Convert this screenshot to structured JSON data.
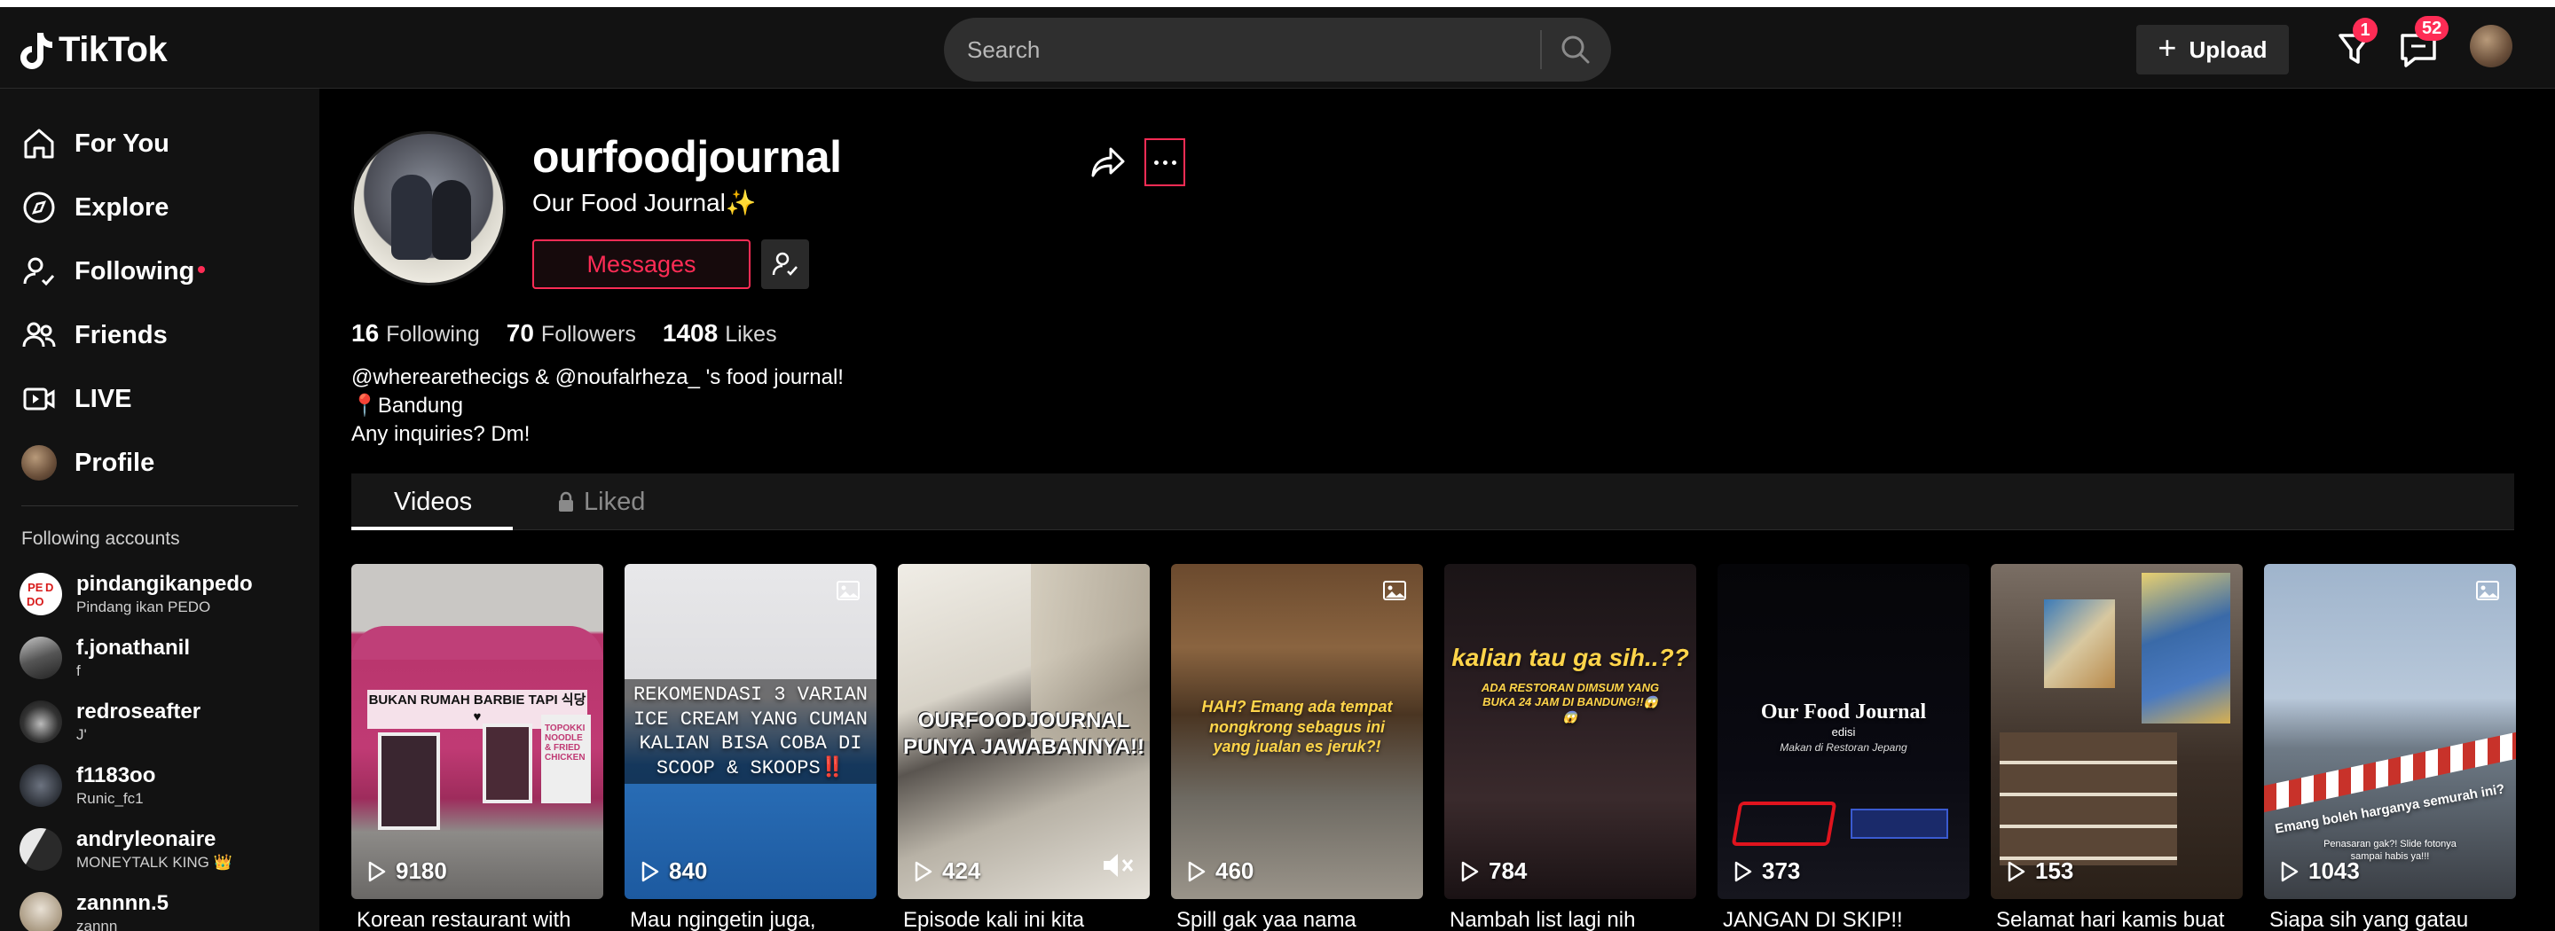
{
  "header": {
    "logo": "TikTok",
    "search_placeholder": "Search",
    "upload_label": "Upload",
    "inbox_badge": "1",
    "messages_badge": "52"
  },
  "sidebar": {
    "nav": [
      {
        "label": "For You",
        "icon": "home-icon"
      },
      {
        "label": "Explore",
        "icon": "compass-icon"
      },
      {
        "label": "Following",
        "icon": "following-icon",
        "dot": true
      },
      {
        "label": "Friends",
        "icon": "friends-icon"
      },
      {
        "label": "LIVE",
        "icon": "live-icon"
      },
      {
        "label": "Profile",
        "icon": "avatar"
      }
    ],
    "following_heading": "Following accounts",
    "accounts": [
      {
        "name": "pindangikanpedo",
        "sub": "Pindang ikan PEDO"
      },
      {
        "name": "f.jonathanil",
        "sub": "f"
      },
      {
        "name": "redroseafter",
        "sub": "J'"
      },
      {
        "name": "f1183oo",
        "sub": "Runic_fc1"
      },
      {
        "name": "andryleonaire",
        "sub": "MONEYTALK KING 👑"
      },
      {
        "name": "zannnn.5",
        "sub": "zannn"
      }
    ]
  },
  "profile": {
    "username": "ourfoodjournal",
    "nickname": "Our Food Journal✨",
    "messages_label": "Messages",
    "following_count": "16",
    "following_label": "Following",
    "followers_count": "70",
    "followers_label": "Followers",
    "likes_count": "1408",
    "likes_label": "Likes",
    "bio": [
      "@wherearethecigs & @noufalrheza_ 's food journal!",
      "📍Bandung",
      "Any inquiries? Dm!"
    ]
  },
  "tabs": {
    "videos": "Videos",
    "liked": "Liked"
  },
  "videos": [
    {
      "views": "9180",
      "caption": "Korean restaurant with",
      "overlay": "BUKAN RUMAH BARBIE TAPI 식당 ♥"
    },
    {
      "views": "840",
      "caption": "Mau ngingetin juga,",
      "overlay": "REKOMENDASI 3 VARIAN ICE CREAM YANG CUMAN KALIAN BISA COBA DI SCOOP & SKOOPS‼️"
    },
    {
      "views": "424",
      "caption": "Episode kali ini kita",
      "overlay": "OURFOODJOURNAL PUNYA JAWABANNYA!!"
    },
    {
      "views": "460",
      "caption": "Spill gak yaa nama",
      "overlay": "HAH? Emang ada tempat nongkrong sebagus ini yang jualan es jeruk?!"
    },
    {
      "views": "784",
      "caption": "Nambah list lagi nih",
      "overlay": "kalian tau ga sih..??",
      "overlay2": "ADA RESTORAN DIMSUM YANG BUKA 24 JAM DI BANDUNG!!😱😱"
    },
    {
      "views": "373",
      "caption": "JANGAN DI SKIP!!",
      "overlay": "Our Food Journal",
      "overlay2": "edisi",
      "overlay3": "Makan di Restoran Jepang"
    },
    {
      "views": "153",
      "caption": "Selamat hari kamis buat"
    },
    {
      "views": "1043",
      "caption": "Siapa sih yang gatau",
      "overlay": "Emang boleh harganya semurah ini?",
      "overlay2": "Penasaran gak?! Slide fotonya sampai habis ya!!!"
    }
  ]
}
